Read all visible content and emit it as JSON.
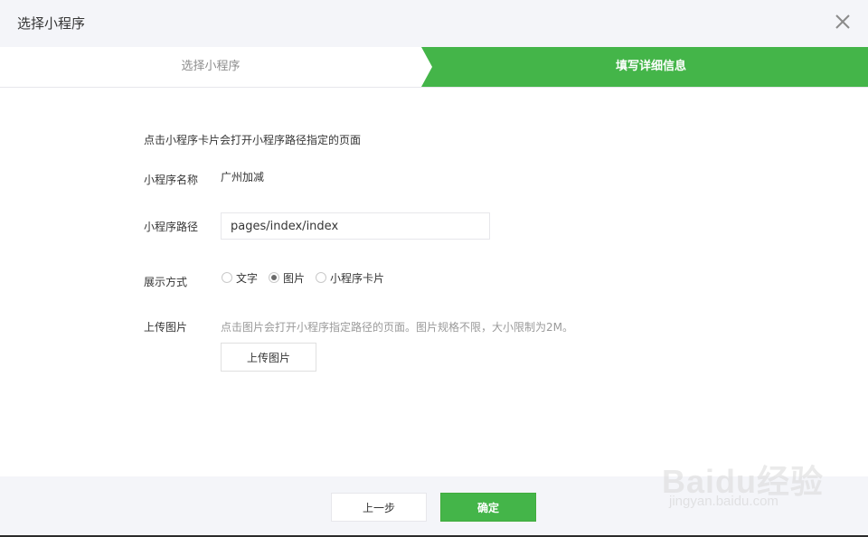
{
  "dialog": {
    "title": "选择小程序",
    "close_icon": "close-icon"
  },
  "steps": [
    {
      "label": "选择小程序",
      "active": false
    },
    {
      "label": "填写详细信息",
      "active": true
    }
  ],
  "form": {
    "hint": "点击小程序卡片会打开小程序路径指定的页面",
    "name_label": "小程序名称",
    "name_value": "广州加减",
    "path_label": "小程序路径",
    "path_value": "pages/index/index",
    "display_label": "展示方式",
    "display_options": [
      {
        "label": "文字",
        "checked": false
      },
      {
        "label": "图片",
        "checked": true
      },
      {
        "label": "小程序卡片",
        "checked": false
      }
    ],
    "upload_label": "上传图片",
    "upload_hint": "点击图片会打开小程序指定路径的页面。图片规格不限，大小限制为2M。",
    "upload_button": "上传图片"
  },
  "footer": {
    "prev_button": "上一步",
    "confirm_button": "确定"
  },
  "watermark": {
    "logo": "Baidu经验",
    "url": "jingyan.baidu.com"
  },
  "colors": {
    "accent": "#44b549",
    "header_bg": "#f4f5f9",
    "border": "#e7e7eb"
  }
}
